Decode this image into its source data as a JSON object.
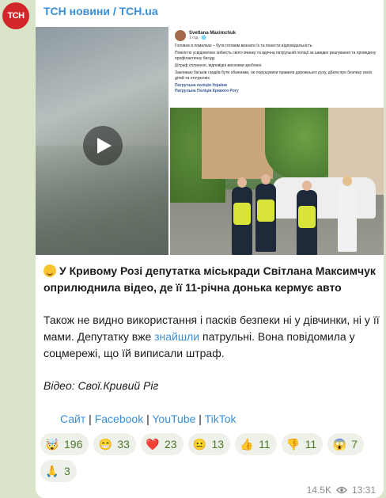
{
  "channel": {
    "avatar_text": "ТСН",
    "name": "ТСН новини / TCH.ua"
  },
  "video": {
    "play_label": "play"
  },
  "embedded_post": {
    "author": "Svetlana Maximchuk",
    "time": "1 год · 🌐",
    "paragraphs": [
      "Головне в помилках – бути готовим визнати їх та понести відповідальність.",
      "Повністю усвідомлюю хибність свого вчинку та вдячна патрульній поліції за швидке реагування та проведену профілактичну бесіду.",
      "Штраф сплачено, відповідні висновки зроблені.",
      "Закликаю батьків і водіїв бути обачними, не порушувати правила дорожнього руху, дбати про безпеку своїх дітей та оточуючих."
    ],
    "tags": [
      "Патрульна поліція України",
      "Патрульна Поліція Кривого Рогу"
    ]
  },
  "headline": "У Кривому Розі депутатка міськради Світлана Максимчук оприлюднила відео, де її 11-річна донька кермує авто",
  "body": {
    "part1": "Також не видно використання і пасків безпеки ні у дівчинки, ні у її мами. Депутатку вже ",
    "link": "знайшли",
    "part2": " патрульні. Вона повідомила у соцмережі, що їй виписали штраф."
  },
  "source": "Відео: Свої.Кривий Ріг",
  "links": [
    "Сайт",
    "Facebook",
    "YouTube",
    "TikTok"
  ],
  "separator": " | ",
  "reactions": [
    {
      "emoji": "🤯",
      "count": "196"
    },
    {
      "emoji": "😁",
      "count": "33"
    },
    {
      "emoji": "❤️",
      "count": "23"
    },
    {
      "emoji": "😐",
      "count": "13"
    },
    {
      "emoji": "👍",
      "count": "11"
    },
    {
      "emoji": "👎",
      "count": "11"
    },
    {
      "emoji": "😱",
      "count": "7"
    },
    {
      "emoji": "🙏",
      "count": "3"
    }
  ],
  "views": "14.5K",
  "time": "13:31",
  "colors": {
    "accent": "#3a8fd6",
    "avatar": "#d3262b",
    "background": "#d9e4c8",
    "reaction_text": "#4c7a2d"
  }
}
